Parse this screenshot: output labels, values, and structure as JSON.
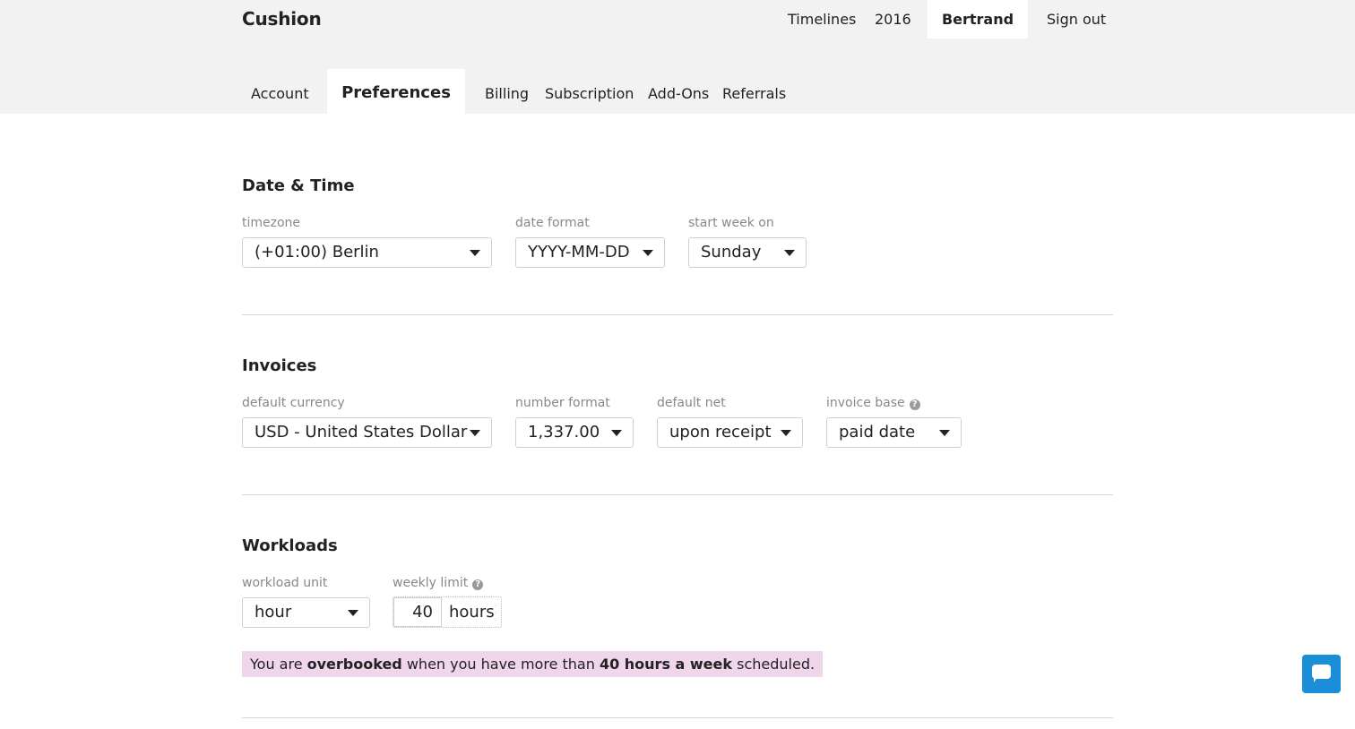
{
  "app": {
    "logo": "Cushion"
  },
  "topnav": {
    "timelines": "Timelines",
    "year": "2016",
    "user": "Bertrand",
    "signout": "Sign out"
  },
  "tabs": {
    "account": "Account",
    "preferences": "Preferences",
    "billing": "Billing",
    "subscription": "Subscription",
    "addons": "Add-Ons",
    "referrals": "Referrals"
  },
  "datetime": {
    "title": "Date & Time",
    "timezone_label": "timezone",
    "timezone_value": "(+01:00) Berlin",
    "date_format_label": "date format",
    "date_format_value": "YYYY-MM-DD",
    "start_week_label": "start week on",
    "start_week_value": "Sunday"
  },
  "invoices": {
    "title": "Invoices",
    "currency_label": "default currency",
    "currency_value": "USD - United States Dollar",
    "number_format_label": "number format",
    "number_format_value": "1,337.00",
    "net_label": "default net",
    "net_value": "upon receipt",
    "invoice_base_label": "invoice base",
    "invoice_base_value": "paid date"
  },
  "workloads": {
    "title": "Workloads",
    "unit_label": "workload unit",
    "unit_value": "hour",
    "limit_label": "weekly limit",
    "limit_value": "40",
    "limit_unit": "hours",
    "notice": {
      "p1": "You are ",
      "b1": "overbooked",
      "p2": " when you have more than ",
      "b2": "40 hours a week",
      "p3": " scheduled."
    }
  },
  "icons": {
    "help": "?"
  },
  "colors": {
    "header_bg": "#f2f2f2",
    "notice_bg": "#efd6ea",
    "chat_accent": "#1a8ed8"
  }
}
